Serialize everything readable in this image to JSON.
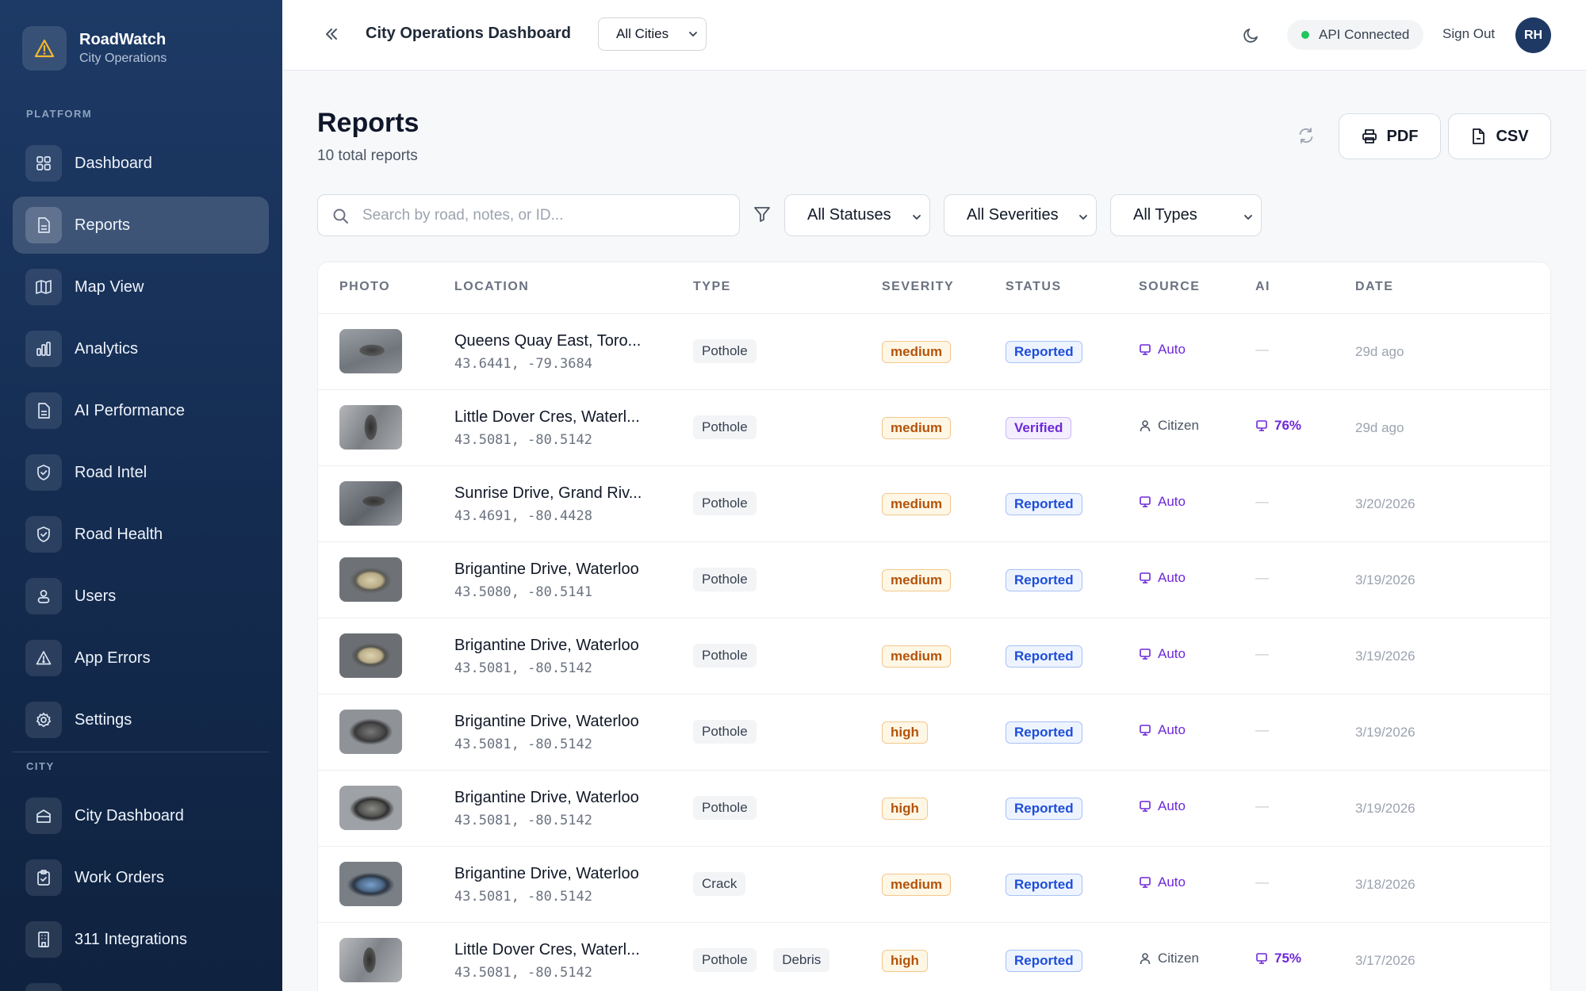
{
  "brand": {
    "title": "RoadWatch",
    "subtitle": "City Operations"
  },
  "sidebar": {
    "platform_label": "PLATFORM",
    "city_label": "CITY",
    "platform_items": [
      {
        "label": "Dashboard",
        "icon": "grid-icon"
      },
      {
        "label": "Reports",
        "icon": "document-icon",
        "active": true
      },
      {
        "label": "Map View",
        "icon": "map-icon"
      },
      {
        "label": "Analytics",
        "icon": "bar-chart-icon"
      },
      {
        "label": "AI Performance",
        "icon": "document-icon"
      },
      {
        "label": "Road Intel",
        "icon": "shield-icon"
      },
      {
        "label": "Road Health",
        "icon": "shield-icon"
      },
      {
        "label": "Users",
        "icon": "users-icon"
      },
      {
        "label": "App Errors",
        "icon": "warning-icon"
      },
      {
        "label": "Settings",
        "icon": "gear-icon"
      }
    ],
    "city_items": [
      {
        "label": "City Dashboard",
        "icon": "building-icon"
      },
      {
        "label": "Work Orders",
        "icon": "clipboard-icon"
      },
      {
        "label": "311 Integrations",
        "icon": "office-icon"
      }
    ]
  },
  "header": {
    "title": "City Operations Dashboard",
    "city_select": "All Cities",
    "api_status": "API Connected",
    "sign_out": "Sign Out",
    "avatar_initials": "RH"
  },
  "page": {
    "title": "Reports",
    "subtitle": "10 total reports",
    "pdf_label": "PDF",
    "csv_label": "CSV"
  },
  "filters": {
    "search_placeholder": "Search by road, notes, or ID...",
    "status": "All Statuses",
    "severity": "All Severities",
    "type": "All Types"
  },
  "table": {
    "columns": [
      "PHOTO",
      "LOCATION",
      "TYPE",
      "SEVERITY",
      "STATUS",
      "SOURCE",
      "AI",
      "DATE"
    ],
    "rows": [
      {
        "location": "Queens Quay East, Toro...",
        "coords": "43.6441, -79.3684",
        "types": [
          "Pothole"
        ],
        "severity": "medium",
        "status": "Reported",
        "source": "Auto",
        "ai": "—",
        "date": "29d ago"
      },
      {
        "location": "Little Dover Cres, Waterl...",
        "coords": "43.5081, -80.5142",
        "types": [
          "Pothole"
        ],
        "severity": "medium",
        "status": "Verified",
        "source": "Citizen",
        "ai": "76%",
        "date": "29d ago"
      },
      {
        "location": "Sunrise Drive, Grand Riv...",
        "coords": "43.4691, -80.4428",
        "types": [
          "Pothole"
        ],
        "severity": "medium",
        "status": "Reported",
        "source": "Auto",
        "ai": "—",
        "date": "3/20/2026"
      },
      {
        "location": "Brigantine Drive, Waterloo",
        "coords": "43.5080, -80.5141",
        "types": [
          "Pothole"
        ],
        "severity": "medium",
        "status": "Reported",
        "source": "Auto",
        "ai": "—",
        "date": "3/19/2026"
      },
      {
        "location": "Brigantine Drive, Waterloo",
        "coords": "43.5081, -80.5142",
        "types": [
          "Pothole"
        ],
        "severity": "medium",
        "status": "Reported",
        "source": "Auto",
        "ai": "—",
        "date": "3/19/2026"
      },
      {
        "location": "Brigantine Drive, Waterloo",
        "coords": "43.5081, -80.5142",
        "types": [
          "Pothole"
        ],
        "severity": "high",
        "status": "Reported",
        "source": "Auto",
        "ai": "—",
        "date": "3/19/2026"
      },
      {
        "location": "Brigantine Drive, Waterloo",
        "coords": "43.5081, -80.5142",
        "types": [
          "Pothole"
        ],
        "severity": "high",
        "status": "Reported",
        "source": "Auto",
        "ai": "—",
        "date": "3/19/2026"
      },
      {
        "location": "Brigantine Drive, Waterloo",
        "coords": "43.5081, -80.5142",
        "types": [
          "Crack"
        ],
        "severity": "medium",
        "status": "Reported",
        "source": "Auto",
        "ai": "—",
        "date": "3/18/2026"
      },
      {
        "location": "Little Dover Cres, Waterl...",
        "coords": "43.5081, -80.5142",
        "types": [
          "Pothole",
          "Debris"
        ],
        "severity": "high",
        "status": "Reported",
        "source": "Citizen",
        "ai": "75%",
        "date": "3/17/2026"
      }
    ]
  }
}
